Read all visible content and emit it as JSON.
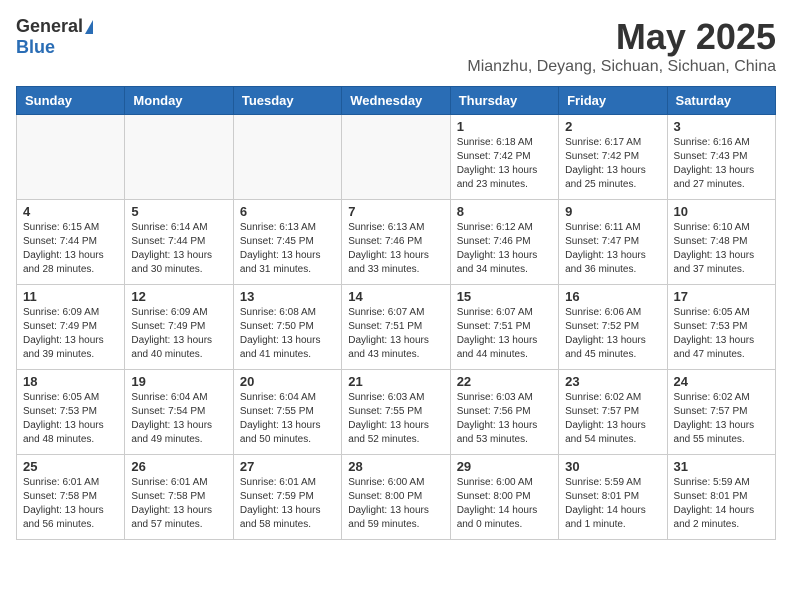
{
  "logo": {
    "general": "General",
    "blue": "Blue"
  },
  "title": {
    "month": "May 2025",
    "location": "Mianzhu, Deyang, Sichuan, Sichuan, China"
  },
  "weekdays": [
    "Sunday",
    "Monday",
    "Tuesday",
    "Wednesday",
    "Thursday",
    "Friday",
    "Saturday"
  ],
  "weeks": [
    [
      {
        "day": "",
        "info": ""
      },
      {
        "day": "",
        "info": ""
      },
      {
        "day": "",
        "info": ""
      },
      {
        "day": "",
        "info": ""
      },
      {
        "day": "1",
        "info": "Sunrise: 6:18 AM\nSunset: 7:42 PM\nDaylight: 13 hours and 23 minutes."
      },
      {
        "day": "2",
        "info": "Sunrise: 6:17 AM\nSunset: 7:42 PM\nDaylight: 13 hours and 25 minutes."
      },
      {
        "day": "3",
        "info": "Sunrise: 6:16 AM\nSunset: 7:43 PM\nDaylight: 13 hours and 27 minutes."
      }
    ],
    [
      {
        "day": "4",
        "info": "Sunrise: 6:15 AM\nSunset: 7:44 PM\nDaylight: 13 hours and 28 minutes."
      },
      {
        "day": "5",
        "info": "Sunrise: 6:14 AM\nSunset: 7:44 PM\nDaylight: 13 hours and 30 minutes."
      },
      {
        "day": "6",
        "info": "Sunrise: 6:13 AM\nSunset: 7:45 PM\nDaylight: 13 hours and 31 minutes."
      },
      {
        "day": "7",
        "info": "Sunrise: 6:13 AM\nSunset: 7:46 PM\nDaylight: 13 hours and 33 minutes."
      },
      {
        "day": "8",
        "info": "Sunrise: 6:12 AM\nSunset: 7:46 PM\nDaylight: 13 hours and 34 minutes."
      },
      {
        "day": "9",
        "info": "Sunrise: 6:11 AM\nSunset: 7:47 PM\nDaylight: 13 hours and 36 minutes."
      },
      {
        "day": "10",
        "info": "Sunrise: 6:10 AM\nSunset: 7:48 PM\nDaylight: 13 hours and 37 minutes."
      }
    ],
    [
      {
        "day": "11",
        "info": "Sunrise: 6:09 AM\nSunset: 7:49 PM\nDaylight: 13 hours and 39 minutes."
      },
      {
        "day": "12",
        "info": "Sunrise: 6:09 AM\nSunset: 7:49 PM\nDaylight: 13 hours and 40 minutes."
      },
      {
        "day": "13",
        "info": "Sunrise: 6:08 AM\nSunset: 7:50 PM\nDaylight: 13 hours and 41 minutes."
      },
      {
        "day": "14",
        "info": "Sunrise: 6:07 AM\nSunset: 7:51 PM\nDaylight: 13 hours and 43 minutes."
      },
      {
        "day": "15",
        "info": "Sunrise: 6:07 AM\nSunset: 7:51 PM\nDaylight: 13 hours and 44 minutes."
      },
      {
        "day": "16",
        "info": "Sunrise: 6:06 AM\nSunset: 7:52 PM\nDaylight: 13 hours and 45 minutes."
      },
      {
        "day": "17",
        "info": "Sunrise: 6:05 AM\nSunset: 7:53 PM\nDaylight: 13 hours and 47 minutes."
      }
    ],
    [
      {
        "day": "18",
        "info": "Sunrise: 6:05 AM\nSunset: 7:53 PM\nDaylight: 13 hours and 48 minutes."
      },
      {
        "day": "19",
        "info": "Sunrise: 6:04 AM\nSunset: 7:54 PM\nDaylight: 13 hours and 49 minutes."
      },
      {
        "day": "20",
        "info": "Sunrise: 6:04 AM\nSunset: 7:55 PM\nDaylight: 13 hours and 50 minutes."
      },
      {
        "day": "21",
        "info": "Sunrise: 6:03 AM\nSunset: 7:55 PM\nDaylight: 13 hours and 52 minutes."
      },
      {
        "day": "22",
        "info": "Sunrise: 6:03 AM\nSunset: 7:56 PM\nDaylight: 13 hours and 53 minutes."
      },
      {
        "day": "23",
        "info": "Sunrise: 6:02 AM\nSunset: 7:57 PM\nDaylight: 13 hours and 54 minutes."
      },
      {
        "day": "24",
        "info": "Sunrise: 6:02 AM\nSunset: 7:57 PM\nDaylight: 13 hours and 55 minutes."
      }
    ],
    [
      {
        "day": "25",
        "info": "Sunrise: 6:01 AM\nSunset: 7:58 PM\nDaylight: 13 hours and 56 minutes."
      },
      {
        "day": "26",
        "info": "Sunrise: 6:01 AM\nSunset: 7:58 PM\nDaylight: 13 hours and 57 minutes."
      },
      {
        "day": "27",
        "info": "Sunrise: 6:01 AM\nSunset: 7:59 PM\nDaylight: 13 hours and 58 minutes."
      },
      {
        "day": "28",
        "info": "Sunrise: 6:00 AM\nSunset: 8:00 PM\nDaylight: 13 hours and 59 minutes."
      },
      {
        "day": "29",
        "info": "Sunrise: 6:00 AM\nSunset: 8:00 PM\nDaylight: 14 hours and 0 minutes."
      },
      {
        "day": "30",
        "info": "Sunrise: 5:59 AM\nSunset: 8:01 PM\nDaylight: 14 hours and 1 minute."
      },
      {
        "day": "31",
        "info": "Sunrise: 5:59 AM\nSunset: 8:01 PM\nDaylight: 14 hours and 2 minutes."
      }
    ]
  ]
}
